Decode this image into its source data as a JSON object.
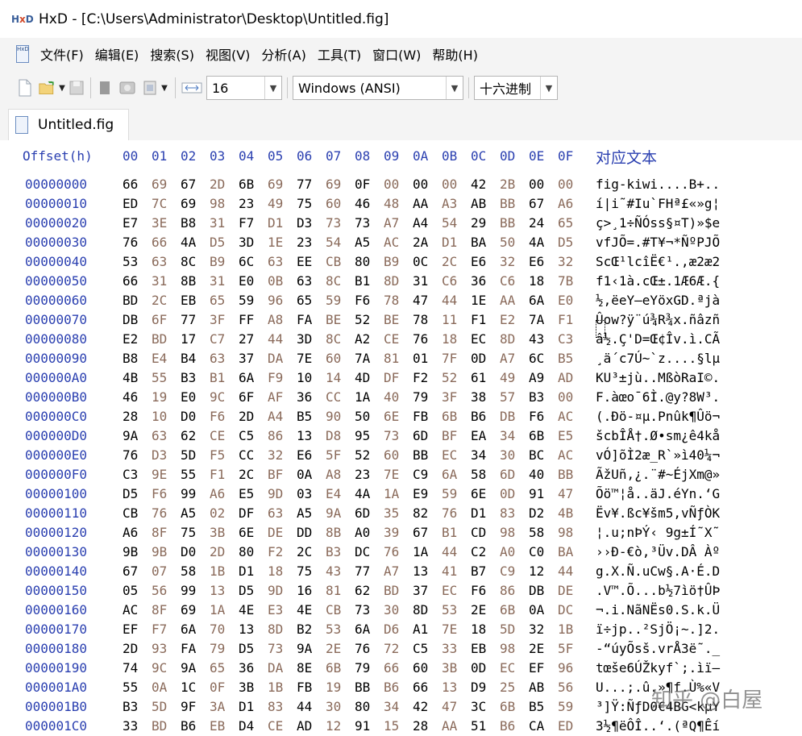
{
  "window": {
    "title": "HxD - [C:\\Users\\Administrator\\Desktop\\Untitled.fig]"
  },
  "menu": [
    "文件(F)",
    "编辑(E)",
    "搜索(S)",
    "视图(V)",
    "分析(A)",
    "工具(T)",
    "窗口(W)",
    "帮助(H)"
  ],
  "toolbar": {
    "bytes_per_row": "16",
    "charset": "Windows (ANSI)",
    "offset_base": "十六进制"
  },
  "tab": {
    "name": "Untitled.fig"
  },
  "editor": {
    "offset_header": "Offset(h)",
    "col_headers": [
      "00",
      "01",
      "02",
      "03",
      "04",
      "05",
      "06",
      "07",
      "08",
      "09",
      "0A",
      "0B",
      "0C",
      "0D",
      "0E",
      "0F"
    ],
    "text_header": "对应文本",
    "rows": [
      {
        "offset": "00000000",
        "bytes": "66 69 67 2D 6B 69 77 69 0F 00 00 00 42 2B 00 00",
        "text": "fig-kiwi....B+.."
      },
      {
        "offset": "00000010",
        "bytes": "ED 7C 69 98 23 49 75 60 46 48 AA A3 AB BB 67 A6",
        "text": "í|i˜#Iu`FHª£«»g¦"
      },
      {
        "offset": "00000020",
        "bytes": "E7 3E B8 31 F7 D1 D3 73 73 A7 A4 54 29 BB 24 65",
        "text": "ç>¸1÷ÑÓss§¤T)»$e"
      },
      {
        "offset": "00000030",
        "bytes": "76 66 4A D5 3D 1E 23 54 A5 AC 2A D1 BA 50 4A D5",
        "text": "vfJÕ=.#T¥¬*ÑºPJÕ"
      },
      {
        "offset": "00000040",
        "bytes": "53 63 8C B9 6C 63 EE CB 80 B9 0C 2C E6 32 E6 32",
        "text": "ScŒ¹lcîË€¹.,æ2æ2"
      },
      {
        "offset": "00000050",
        "bytes": "66 31 8B 31 E0 0B 63 8C B1 8D 31 C6 36 C6 18 7B",
        "text": "f1‹1à.cŒ±.1Æ6Æ.{"
      },
      {
        "offset": "00000060",
        "bytes": "BD 2C EB 65 59 96 65 59 F6 78 47 44 1E AA 6A E0",
        "text": "½,ëeY–eYöxGD.ªjà"
      },
      {
        "offset": "00000070",
        "bytes": "DB 6F 77 3F FF A8 FA BE 52 BE 78 11 F1 E2 7A F1",
        "text": "Ûow?ÿ¨ú¾R¾x.ñâzñ"
      },
      {
        "offset": "00000080",
        "bytes": "E2 BD 17 C7 27 44 3D 8C A2 CE 76 18 EC 8D 43 C3",
        "text": "â½.Ç'D=Œ¢Îv.ì.CÃ"
      },
      {
        "offset": "00000090",
        "bytes": "B8 E4 B4 63 37 DA 7E 60 7A 81 01 7F 0D A7 6C B5",
        "text": "¸ä´c7Ú~`z....§lµ"
      },
      {
        "offset": "000000A0",
        "bytes": "4B 55 B3 B1 6A F9 10 14 4D DF F2 52 61 49 A9 AD",
        "text": "KU³±jù..MßòRaI©."
      },
      {
        "offset": "000000B0",
        "bytes": "46 19 E0 9C 6F AF 36 CC 1A 40 79 3F 38 57 B3 00",
        "text": "F.àœo¯6Ì.@y?8W³."
      },
      {
        "offset": "000000C0",
        "bytes": "28 10 D0 F6 2D A4 B5 90 50 6E FB 6B B6 DB F6 AC",
        "text": "(.Ðö-¤µ.Pnûk¶Ûö¬"
      },
      {
        "offset": "000000D0",
        "bytes": "9A 63 62 CE C5 86 13 D8 95 73 6D BF EA 34 6B E5",
        "text": "šcbÎÅ†.Ø•sm¿ê4kå"
      },
      {
        "offset": "000000E0",
        "bytes": "76 D3 5D F5 CC 32 E6 5F 52 60 BB EC 34 30 BC AC",
        "text": "vÓ]õÌ2æ_R`»ì40¼¬"
      },
      {
        "offset": "000000F0",
        "bytes": "C3 9E 55 F1 2C BF 0A A8 23 7E C9 6A 58 6D 40 BB",
        "text": "ÃžUñ,¿.¨#~ÉjXm@»"
      },
      {
        "offset": "00000100",
        "bytes": "D5 F6 99 A6 E5 9D 03 E4 4A 1A E9 59 6E 0D 91 47",
        "text": "Õö™¦å..äJ.éYn.‘G"
      },
      {
        "offset": "00000110",
        "bytes": "CB 76 A5 02 DF 63 A5 9A 6D 35 82 76 D1 83 D2 4B",
        "text": "Ëv¥.ßc¥šm5‚vÑƒÒK"
      },
      {
        "offset": "00000120",
        "bytes": "A6 8F 75 3B 6E DE DD 8B A0 39 67 B1 CD 98 58 98",
        "text": "¦.u;nÞÝ‹ 9g±Í˜X˜"
      },
      {
        "offset": "00000130",
        "bytes": "9B 9B D0 2D 80 F2 2C B3 DC 76 1A 44 C2 A0 C0 BA",
        "text": "››Ð-€ò,³Üv.DÂ Àº"
      },
      {
        "offset": "00000140",
        "bytes": "67 07 58 1B D1 18 75 43 77 A7 13 41 B7 C9 12 44",
        "text": "g.X.Ñ.uCw§.A·É.D"
      },
      {
        "offset": "00000150",
        "bytes": "05 56 99 13 D5 9D 16 81 62 BD 37 EC F6 86 DB DE",
        "text": ".V™.Õ...b½7ìö†ÛÞ"
      },
      {
        "offset": "00000160",
        "bytes": "AC 8F 69 1A 4E E3 4E CB 73 30 8D 53 2E 6B 0A DC",
        "text": "¬.i.NãNËs0.S.k.Ü"
      },
      {
        "offset": "00000170",
        "bytes": "EF F7 6A 70 13 8D B2 53 6A D6 A1 7E 18 5D 32 1B",
        "text": "ï÷jp..²SjÖ¡~.]2."
      },
      {
        "offset": "00000180",
        "bytes": "2D 93 FA 79 D5 73 9A 2E 76 72 C5 33 EB 98 2E 5F",
        "text": "-“úyÕsš.vrÅ3ë˜._"
      },
      {
        "offset": "00000190",
        "bytes": "74 9C 9A 65 36 DA 8E 6B 79 66 60 3B 0D EC EF 96",
        "text": "tœše6ÚŽkyf`;.ìï–"
      },
      {
        "offset": "000001A0",
        "bytes": "55 0A 1C 0F 3B 1B FB 19 BB B6 66 13 D9 25 AB 56",
        "text": "U...;.û.»¶f.Ù%«V"
      },
      {
        "offset": "000001B0",
        "bytes": "B3 5D 9F 3A D1 83 44 30 80 34 42 47 3C 6B B5 59",
        "text": "³]Ÿ:ÑƒD0€4BG<kµY"
      },
      {
        "offset": "000001C0",
        "bytes": "33 BD B6 EB D4 CE AD 12 91 15 28 AA 51 B6 CA ED",
        "text": "3½¶ëÔÎ..‘.(ªQ¶Êí"
      }
    ]
  },
  "watermark": "知乎 @白屋"
}
